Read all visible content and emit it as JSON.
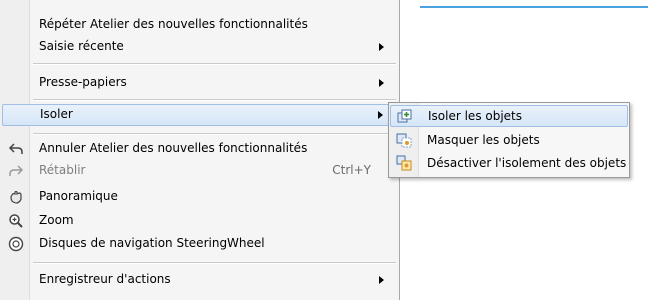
{
  "menu": {
    "items": [
      {
        "label": "Répéter Atelier des nouvelles fonctionnalités"
      },
      {
        "label": "Saisie récente"
      },
      {
        "label": "Presse-papiers"
      },
      {
        "label": "Isoler"
      },
      {
        "label": "Annuler Atelier des nouvelles fonctionnalités",
        "icon": "undo-icon"
      },
      {
        "label": "Rétablir",
        "shortcut": "Ctrl+Y",
        "icon": "redo-icon"
      },
      {
        "label": "Panoramique",
        "icon": "pan-icon"
      },
      {
        "label": "Zoom",
        "icon": "zoom-icon"
      },
      {
        "label": "Disques de navigation SteeringWheel",
        "icon": "steeringwheel-icon"
      },
      {
        "label": "Enregistreur d'actions"
      }
    ]
  },
  "submenu": {
    "items": [
      {
        "label": "Isoler les objets",
        "icon": "isolate-objects-icon"
      },
      {
        "label": "Masquer les objets",
        "icon": "hide-objects-icon"
      },
      {
        "label": "Désactiver l'isolement des objets",
        "icon": "end-isolation-icon"
      }
    ]
  },
  "colors": {
    "hover": "#d6e6f8",
    "accent": "#4aa3df"
  }
}
